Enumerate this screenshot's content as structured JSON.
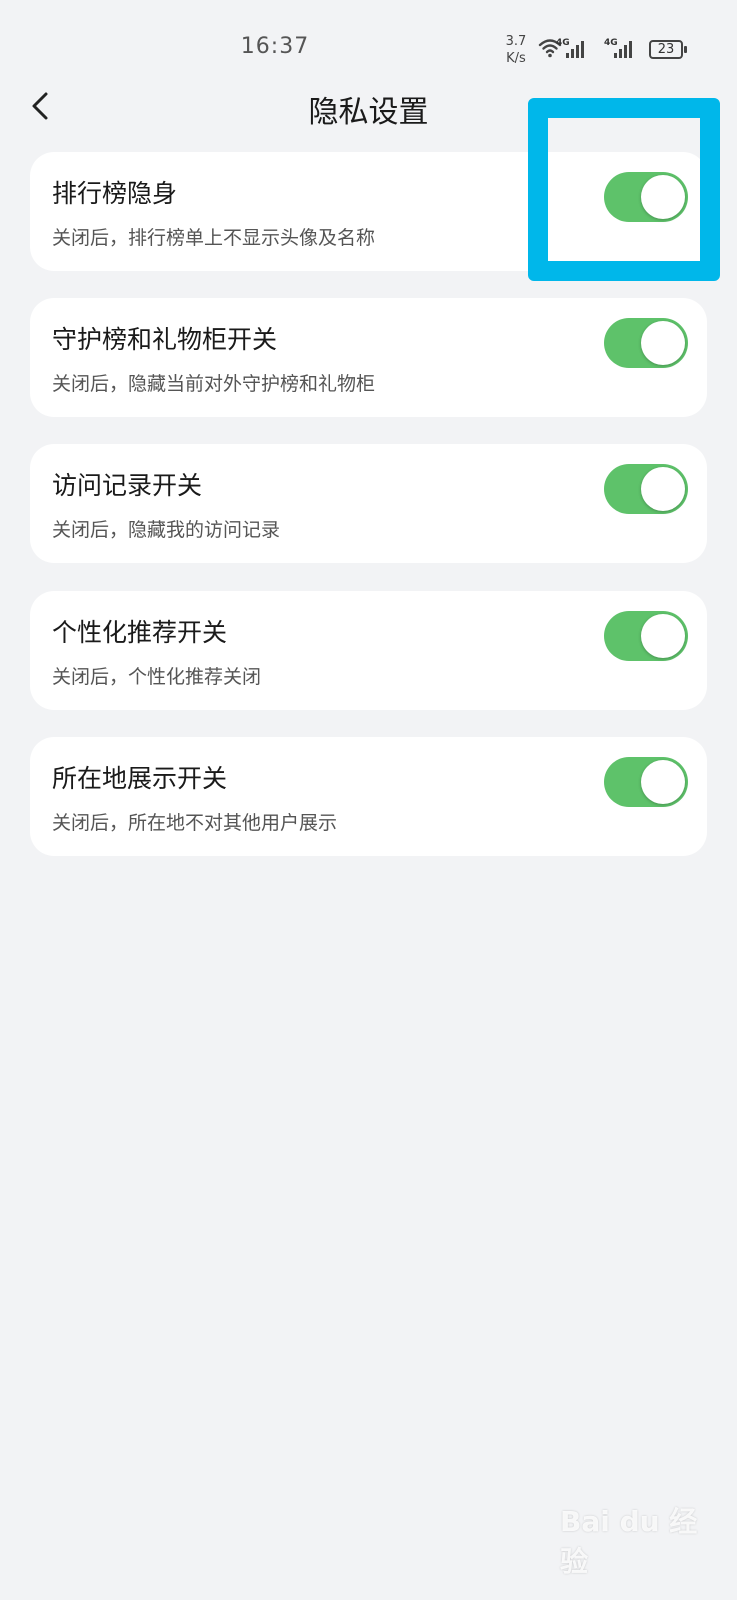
{
  "status_bar": {
    "time": "16:37",
    "net_speed_value": "3.7",
    "net_speed_unit": "K/s",
    "sim1_type": "4G",
    "sim2_type": "4G",
    "battery_level": "23",
    "icons": [
      "wifi-icon",
      "signal-icon",
      "battery-icon"
    ]
  },
  "header": {
    "title": "隐私设置",
    "back_icon": "chevron-left-icon"
  },
  "settings": [
    {
      "title": "排行榜隐身",
      "desc": "关闭后，排行榜单上不显示头像及名称",
      "enabled": true
    },
    {
      "title": "守护榜和礼物柜开关",
      "desc": "关闭后，隐藏当前对外守护榜和礼物柜",
      "enabled": true
    },
    {
      "title": "访问记录开关",
      "desc": "关闭后，隐藏我的访问记录",
      "enabled": true
    },
    {
      "title": "个性化推荐开关",
      "desc": "关闭后，个性化推荐关闭",
      "enabled": true
    },
    {
      "title": "所在地展示开关",
      "desc": "关闭后，所在地不对其他用户展示",
      "enabled": true
    }
  ],
  "colors": {
    "toggle_on": "#5ec26a",
    "highlight": "#00b7ea",
    "background": "#f2f3f5"
  },
  "watermark": {
    "text": "Bai du 经验"
  }
}
